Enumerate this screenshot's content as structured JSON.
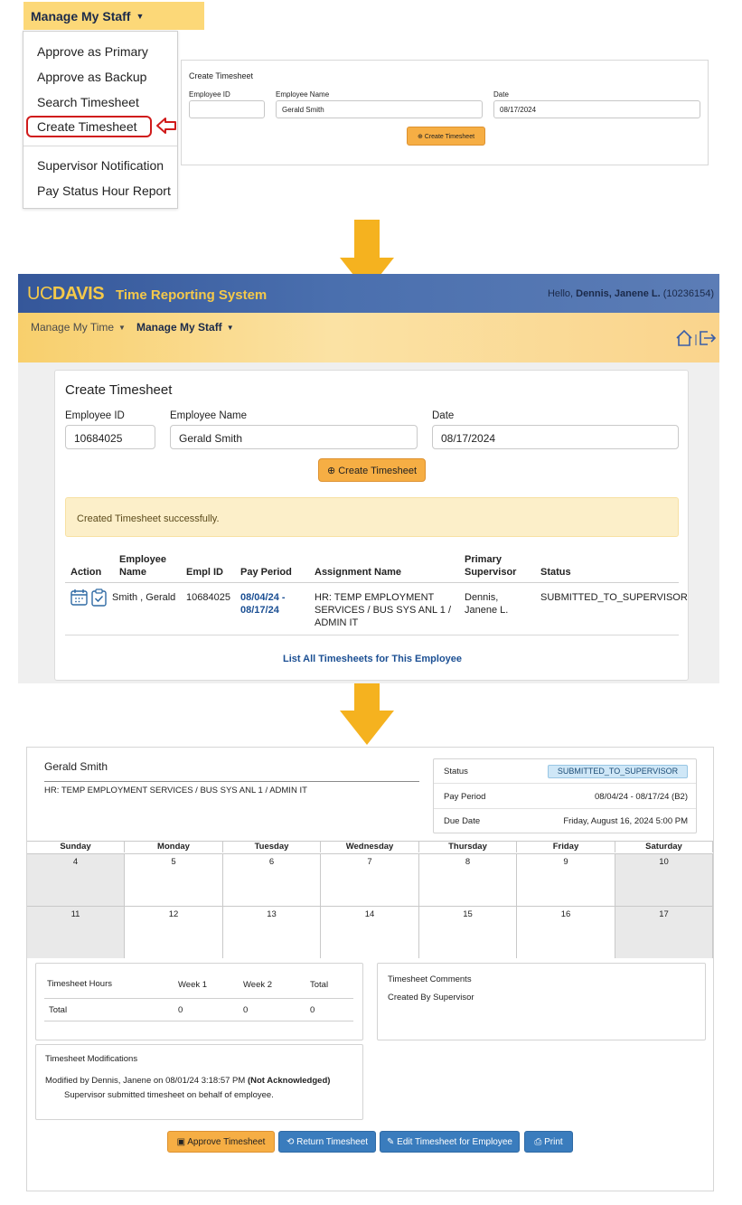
{
  "panel1": {
    "menu_title": "Manage My Staff",
    "caret": "▼",
    "dropdown_items": [
      "Approve as Primary",
      "Approve as Backup",
      "Search Timesheet",
      "Create Timesheet",
      "Supervisor Notification",
      "Pay Status Hour Report"
    ],
    "form": {
      "title": "Create Timesheet",
      "employee_id_label": "Employee ID",
      "employee_id_value": "",
      "employee_name_label": "Employee Name",
      "employee_name_value": "Gerald Smith",
      "date_label": "Date",
      "date_value": "08/17/2024",
      "button": "Create Timesheet"
    }
  },
  "panel2": {
    "logo_uc": "UC",
    "logo_davis": "DAVIS",
    "app_name": "Time Reporting System",
    "hello_prefix": "Hello,",
    "hello_name": "Dennis, Janene L.",
    "hello_id": "(10236154)",
    "nav": [
      "Manage My Time",
      "Manage My Staff"
    ],
    "form": {
      "title": "Create Timesheet",
      "employee_id_label": "Employee ID",
      "employee_id_value": "10684025",
      "employee_name_label": "Employee Name",
      "employee_name_value": "Gerald Smith",
      "date_label": "Date",
      "date_value": "08/17/2024",
      "button": "Create Timesheet"
    },
    "alert": "Created Timesheet successfully.",
    "table": {
      "headers": {
        "action": "Action",
        "employee_name_1": "Employee",
        "employee_name_2": "Name",
        "empl_id": "Empl ID",
        "pay_period": "Pay Period",
        "assignment": "Assignment Name",
        "supervisor_1": "Primary",
        "supervisor_2": "Supervisor",
        "status": "Status"
      },
      "row": {
        "employee_name": "Smith , Gerald",
        "empl_id": "10684025",
        "pay_period_1": "08/04/24 -",
        "pay_period_2": "08/17/24",
        "assignment_1": "HR: TEMP EMPLOYMENT",
        "assignment_2": "SERVICES / BUS SYS ANL 1 /",
        "assignment_3": "ADMIN IT",
        "supervisor_1": "Dennis,",
        "supervisor_2": "Janene L.",
        "status": "SUBMITTED_TO_SUPERVISOR"
      }
    },
    "list_all": "List All Timesheets for This Employee"
  },
  "panel3": {
    "employee_name": "Gerald Smith",
    "assignment": "HR: TEMP EMPLOYMENT SERVICES / BUS SYS ANL 1 / ADMIN IT",
    "status": {
      "status_label": "Status",
      "status_value": "SUBMITTED_TO_SUPERVISOR",
      "pay_period_label": "Pay Period",
      "pay_period_value": "08/04/24 - 08/17/24 (B2)",
      "due_date_label": "Due Date",
      "due_date_value": "Friday, August 16, 2024 5:00 PM"
    },
    "calendar": {
      "days": [
        "Sunday",
        "Monday",
        "Tuesday",
        "Wednesday",
        "Thursday",
        "Friday",
        "Saturday"
      ],
      "week1": [
        "4",
        "5",
        "6",
        "7",
        "8",
        "9",
        "10"
      ],
      "week2": [
        "11",
        "12",
        "13",
        "14",
        "15",
        "16",
        "17"
      ]
    },
    "hours": {
      "title": "Timesheet Hours",
      "week1": "Week 1",
      "week2": "Week 2",
      "total": "Total",
      "row_label": "Total",
      "row_week1": "0",
      "row_week2": "0",
      "row_total": "0"
    },
    "comments": {
      "title": "Timesheet Comments",
      "text": "Created By Supervisor"
    },
    "modifications": {
      "title": "Timesheet Modifications",
      "line1": "Modified by Dennis, Janene on 08/01/24 3:18:57 PM",
      "line1_bold": "(Not Acknowledged)",
      "line2": "Supervisor submitted timesheet on behalf of employee."
    },
    "buttons": {
      "approve": "Approve Timesheet",
      "return": "Return Timesheet",
      "edit": "Edit Timesheet for Employee",
      "print": "Print"
    }
  },
  "colors": {
    "accent_orange": "#f6ae44",
    "arrow_yellow": "#f5b21f",
    "link_blue": "#1b4f93",
    "header_blue": "#35579a",
    "highlight_red": "#d01b1b"
  }
}
